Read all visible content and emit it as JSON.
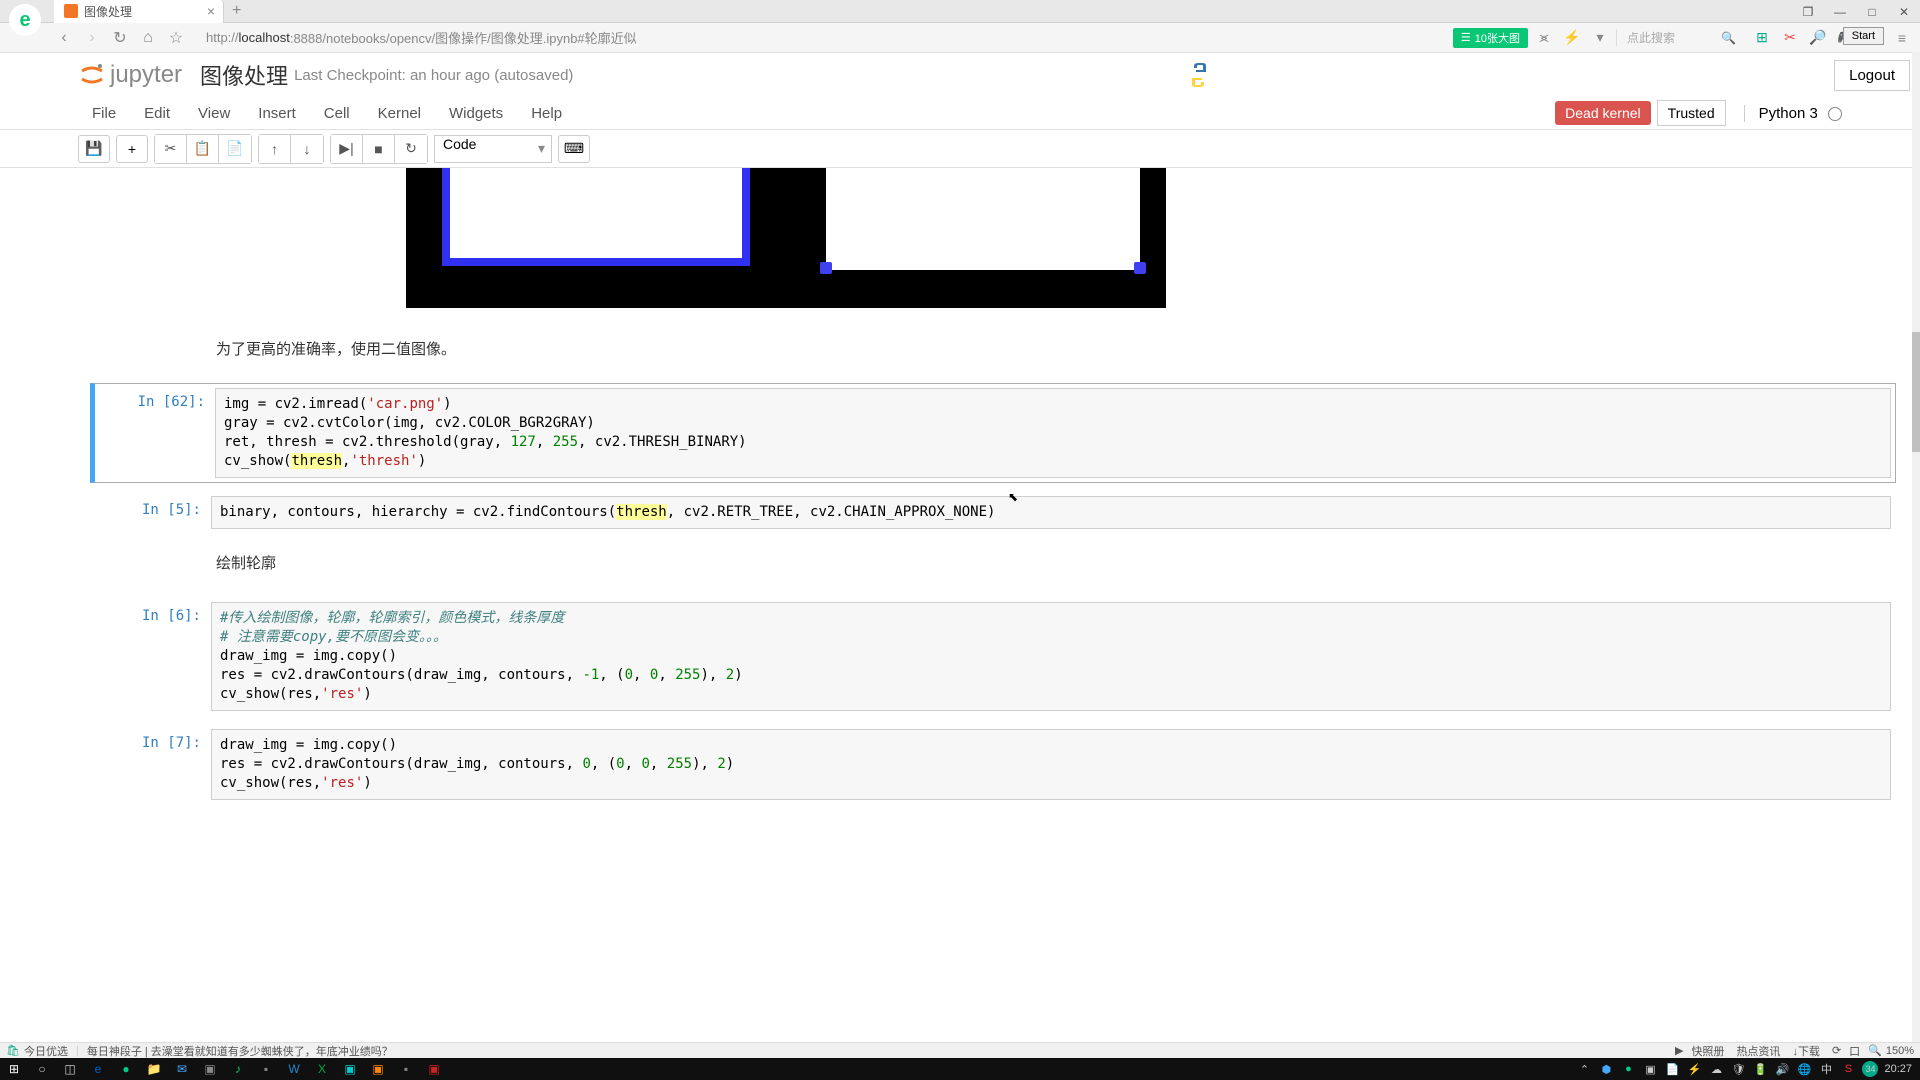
{
  "browser": {
    "tab_title": "图像处理",
    "url_prefix": "http://",
    "url_host": "localhost",
    "url_path": ":8888/notebooks/opencv/图像操作/图像处理.ipynb#轮廓近似",
    "green_btn": "10张大图",
    "search_placeholder": "点此搜索",
    "start_label": "Start"
  },
  "jupyter": {
    "logo_text": "jupyter",
    "title": "图像处理",
    "checkpoint": "Last Checkpoint: an hour ago (autosaved)",
    "logout": "Logout",
    "menu": [
      "File",
      "Edit",
      "View",
      "Insert",
      "Cell",
      "Kernel",
      "Widgets",
      "Help"
    ],
    "dead_kernel": "Dead kernel",
    "trusted": "Trusted",
    "kernel": "Python 3",
    "cell_type": "Code"
  },
  "cells": {
    "md1": "为了更高的准确率，使用二值图像。",
    "md2": "绘制轮廓",
    "p62": "In [62]:",
    "p5": "In [5]:",
    "p6": "In [6]:",
    "p7": "In [7]:"
  },
  "code": {
    "c62_l1_a": "img = cv2.imread(",
    "c62_l1_s": "'car.png'",
    "c62_l1_b": ")",
    "c62_l2": "gray = cv2.cvtColor(img, cv2.COLOR_BGR2GRAY)",
    "c62_l3_a": "ret, thresh = cv2.threshold(gray, ",
    "c62_l3_n1": "127",
    "c62_l3_b": ", ",
    "c62_l3_n2": "255",
    "c62_l3_c": ", cv2.THRESH_BINARY)",
    "c62_l4_a": "cv_show(",
    "c62_l4_h": "thresh",
    "c62_l4_b": ",",
    "c62_l4_s": "'thresh'",
    "c62_l4_c": ")",
    "c5_a": "binary, contours, hierarchy = cv2.findContours(",
    "c5_h": "thresh",
    "c5_b": ", cv2.RETR_TREE, cv2.CHAIN_APPROX_NONE)",
    "c6_l1": "#传入绘制图像，轮廓，轮廓索引，颜色模式，线条厚度",
    "c6_l2": "# 注意需要copy,要不原图会变。。。",
    "c6_l3": "draw_img = img.copy()",
    "c6_l4_a": "res = cv2.drawContours(draw_img, contours, ",
    "c6_l4_n1": "-1",
    "c6_l4_b": ", (",
    "c6_l4_n2": "0",
    "c6_l4_c": ", ",
    "c6_l4_n3": "0",
    "c6_l4_d": ", ",
    "c6_l4_n4": "255",
    "c6_l4_e": "), ",
    "c6_l4_n5": "2",
    "c6_l4_f": ")",
    "c6_l5_a": "cv_show(res,",
    "c6_l5_s": "'res'",
    "c6_l5_b": ")",
    "c7_l1": "draw_img = img.copy()",
    "c7_l2_a": "res = cv2.drawContours(draw_img, contours, ",
    "c7_l2_n1": "0",
    "c7_l2_b": ", (",
    "c7_l2_n2": "0",
    "c7_l2_c": ", ",
    "c7_l2_n3": "0",
    "c7_l2_d": ", ",
    "c7_l2_n4": "255",
    "c7_l2_e": "), ",
    "c7_l2_n5": "2",
    "c7_l2_f": ")",
    "c7_l3_a": "cv_show(res,",
    "c7_l3_s": "'res'",
    "c7_l3_b": ")"
  },
  "taskbar": {
    "status_left": "今日优选",
    "status_mid": "每日神段子 | 去澡堂看就知道有多少蜘蛛侠了，年底冲业绩吗？",
    "status_r1": "快照册",
    "status_r2": "热点资讯",
    "status_r3": "↓下载",
    "time": "20:27",
    "zoom": "150%",
    "tray_num": "34"
  }
}
